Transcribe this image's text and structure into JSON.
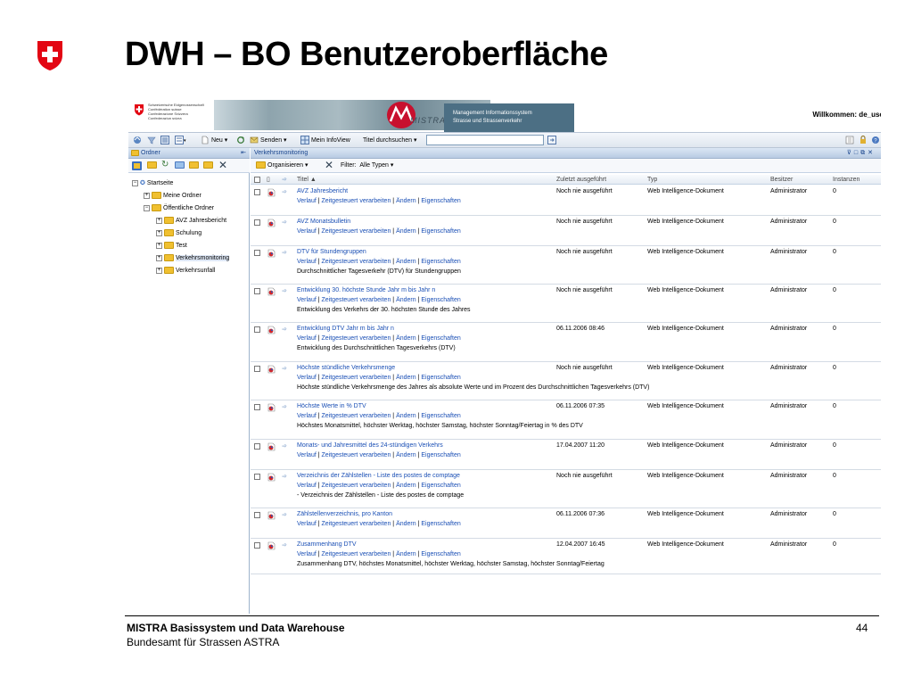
{
  "slide": {
    "title": "DWH – BO Benutzeroberfläche",
    "footer_line1": "MISTRA Basissystem und Data Warehouse",
    "footer_line2": "Bundesamt für Strassen ASTRA",
    "page_number": "44"
  },
  "banner": {
    "gov_lines": [
      "Schweizerische Eidgenossenschaft",
      "Confédération suisse",
      "Confederazione Svizzera",
      "Confederaziun svizra"
    ],
    "mistra": "MISTRA",
    "mis_line1": "Management Informationssystem",
    "mis_line2": "Strasse und Strassenverkehr",
    "welcome": "Willkommen: de_user"
  },
  "toolbar": {
    "new": "Neu",
    "send": "Senden",
    "my_infoview": "Mein InfoView",
    "search_mode": "Titel durchsuchen",
    "search_value": ""
  },
  "left_pane": {
    "header": "Ordner",
    "tree": [
      {
        "label": "Startseite",
        "level": 0,
        "toggle": "⊟"
      },
      {
        "label": "Meine Ordner",
        "level": 1,
        "toggle": "+"
      },
      {
        "label": "Öffentliche Ordner",
        "level": 1,
        "toggle": "−"
      },
      {
        "label": "AVZ Jahresbericht",
        "level": 2,
        "toggle": "+"
      },
      {
        "label": "Schulung",
        "level": 2,
        "toggle": "+"
      },
      {
        "label": "Test",
        "level": 2,
        "toggle": "+"
      },
      {
        "label": "Verkehrsmonitoring",
        "level": 2,
        "toggle": "+",
        "selected": true
      },
      {
        "label": "Verkehrsunfall",
        "level": 2,
        "toggle": "+"
      }
    ]
  },
  "right_pane": {
    "header": "Verkehrsmonitoring",
    "organize": "Organisieren",
    "filter_label": "Filter:",
    "filter_value": "Alle Typen",
    "columns": {
      "title": "Titel ▲",
      "last_run": "Zuletzt ausgeführt",
      "type": "Typ",
      "owner": "Besitzer",
      "instances": "Instanzen"
    },
    "link_labels": {
      "history": "Verlauf",
      "scheduled": "Zeitgesteuert verarbeiten",
      "edit": "Ändern",
      "props": "Eigenschaften"
    },
    "rows": [
      {
        "title": "AVZ Jahresbericht",
        "desc": "",
        "last_run": "Noch nie ausgeführt",
        "type": "Web Intelligence-Dokument",
        "owner": "Administrator",
        "instances": "0"
      },
      {
        "title": "AVZ Monatsbulletin",
        "desc": "",
        "last_run": "Noch nie ausgeführt",
        "type": "Web Intelligence-Dokument",
        "owner": "Administrator",
        "instances": "0"
      },
      {
        "title": "DTV für Stundengruppen",
        "desc": "Durchschnittlicher Tagesverkehr (DTV) für Stundengruppen",
        "last_run": "Noch nie ausgeführt",
        "type": "Web Intelligence-Dokument",
        "owner": "Administrator",
        "instances": "0"
      },
      {
        "title": "Entwicklung 30. höchste Stunde Jahr m bis Jahr n",
        "desc": "Entwicklung des Verkehrs der 30. höchsten Stunde des Jahres",
        "last_run": "Noch nie ausgeführt",
        "type": "Web Intelligence-Dokument",
        "owner": "Administrator",
        "instances": "0"
      },
      {
        "title": "Entwicklung DTV Jahr m bis Jahr n",
        "desc": "Entwicklung des Durchschnittlichen Tagesverkehrs (DTV)",
        "last_run": "06.11.2006 08:46",
        "type": "Web Intelligence-Dokument",
        "owner": "Administrator",
        "instances": "0"
      },
      {
        "title": "Höchste stündliche Verkehrsmenge",
        "desc": "Höchste stündliche Verkehrsmenge des Jahres als absolute Werte und im Prozent des Durchschnittlichen Tagesverkehrs (DTV)",
        "last_run": "Noch nie ausgeführt",
        "type": "Web Intelligence-Dokument",
        "owner": "Administrator",
        "instances": "0"
      },
      {
        "title": "Höchste Werte in % DTV",
        "desc": "Höchstes Monatsmittel, höchster Werktag, höchster Samstag, höchster Sonntag/Feiertag in % des DTV",
        "last_run": "06.11.2006 07:35",
        "type": "Web Intelligence-Dokument",
        "owner": "Administrator",
        "instances": "0"
      },
      {
        "title": "Monats- und Jahresmittel des 24-stündigen Verkehrs",
        "desc": "",
        "last_run": "17.04.2007 11:20",
        "type": "Web Intelligence-Dokument",
        "owner": "Administrator",
        "instances": "0"
      },
      {
        "title": "Verzeichnis der Zählstellen - Liste des postes de comptage",
        "desc": "- Verzeichnis der Zählstellen - Liste des postes de comptage",
        "last_run": "Noch nie ausgeführt",
        "type": "Web Intelligence-Dokument",
        "owner": "Administrator",
        "instances": "0"
      },
      {
        "title": "Zählstellenverzeichnis, pro Kanton",
        "desc": "",
        "last_run": "06.11.2006 07:36",
        "type": "Web Intelligence-Dokument",
        "owner": "Administrator",
        "instances": "0"
      },
      {
        "title": "Zusammenhang DTV",
        "desc": "Zusammenhang DTV, höchstes Monatsmittel, höchster Werktag, höchster Samstag, höchster Sonntag/Feiertag",
        "last_run": "12.04.2007 16:45",
        "type": "Web Intelligence-Dokument",
        "owner": "Administrator",
        "instances": "0"
      }
    ]
  }
}
